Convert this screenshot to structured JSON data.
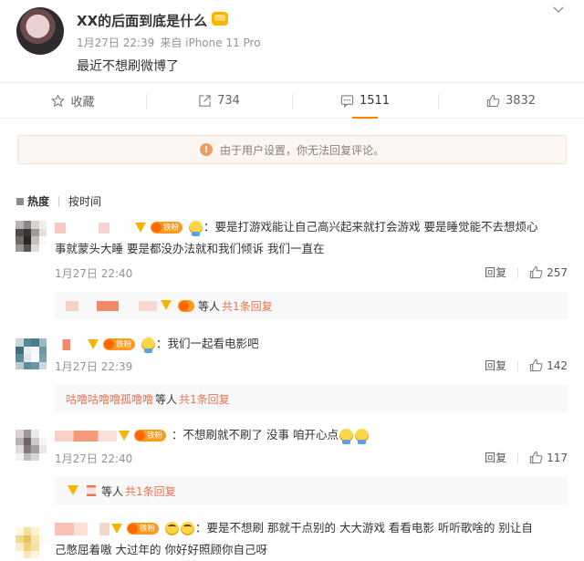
{
  "post": {
    "author": "XX的后面到底是什么",
    "date": "1月27日 22:39",
    "source": "来自 iPhone 11 Pro",
    "text": "最近不想刷微博了"
  },
  "actions": {
    "favorite_label": "收藏",
    "repost_count": "734",
    "comment_count": "1511",
    "like_count": "3832"
  },
  "notice": {
    "icon_glyph": "!",
    "text": "由于用户设置，你无法回复评论。"
  },
  "sort": {
    "hot": "热度",
    "time": "按时间"
  },
  "fan_badge_label": "铁粉",
  "reply_label": "回复",
  "comments": [
    {
      "text_line1": "：要是打游戏能让自己高兴起来就打会游戏 要是睡觉能不去想烦心",
      "text_line2": "事就蒙头大睡 要是都没办法就和我们倾诉 我们一直在",
      "time": "1月27日 22:40",
      "likes": "257",
      "sub_suffix": "等人",
      "sub_link": "共1条回复"
    },
    {
      "text_line1": "：我们一起看电影吧",
      "time": "1月27日 22:39",
      "likes": "142",
      "sub_names": "咕噜咕噜噜孤噜噜",
      "sub_suffix": "等人",
      "sub_link": "共1条回复"
    },
    {
      "text_line1": "：不想刷就不刷了 没事 咱开心点",
      "time": "1月27日 22:40",
      "likes": "117",
      "sub_suffix": "等人",
      "sub_link": "共1条回复"
    },
    {
      "text_line1": "：要是不想刷 那就干点别的 大大游戏 看看电影 听听歌啥的  别让自",
      "text_line2": "己憋屈着嗷 大过年的 你好好照顾你自己呀"
    }
  ],
  "colors": {
    "accent": "#ff8200",
    "link": "#eb7350",
    "muted": "#939393",
    "reply_bg": "#f8f8f8",
    "notice_bg": "#fcf6f2"
  },
  "icons": [
    "star-icon",
    "share-icon",
    "comment-icon",
    "thumbs-up-icon",
    "chevron-down-icon",
    "warning-icon"
  ]
}
